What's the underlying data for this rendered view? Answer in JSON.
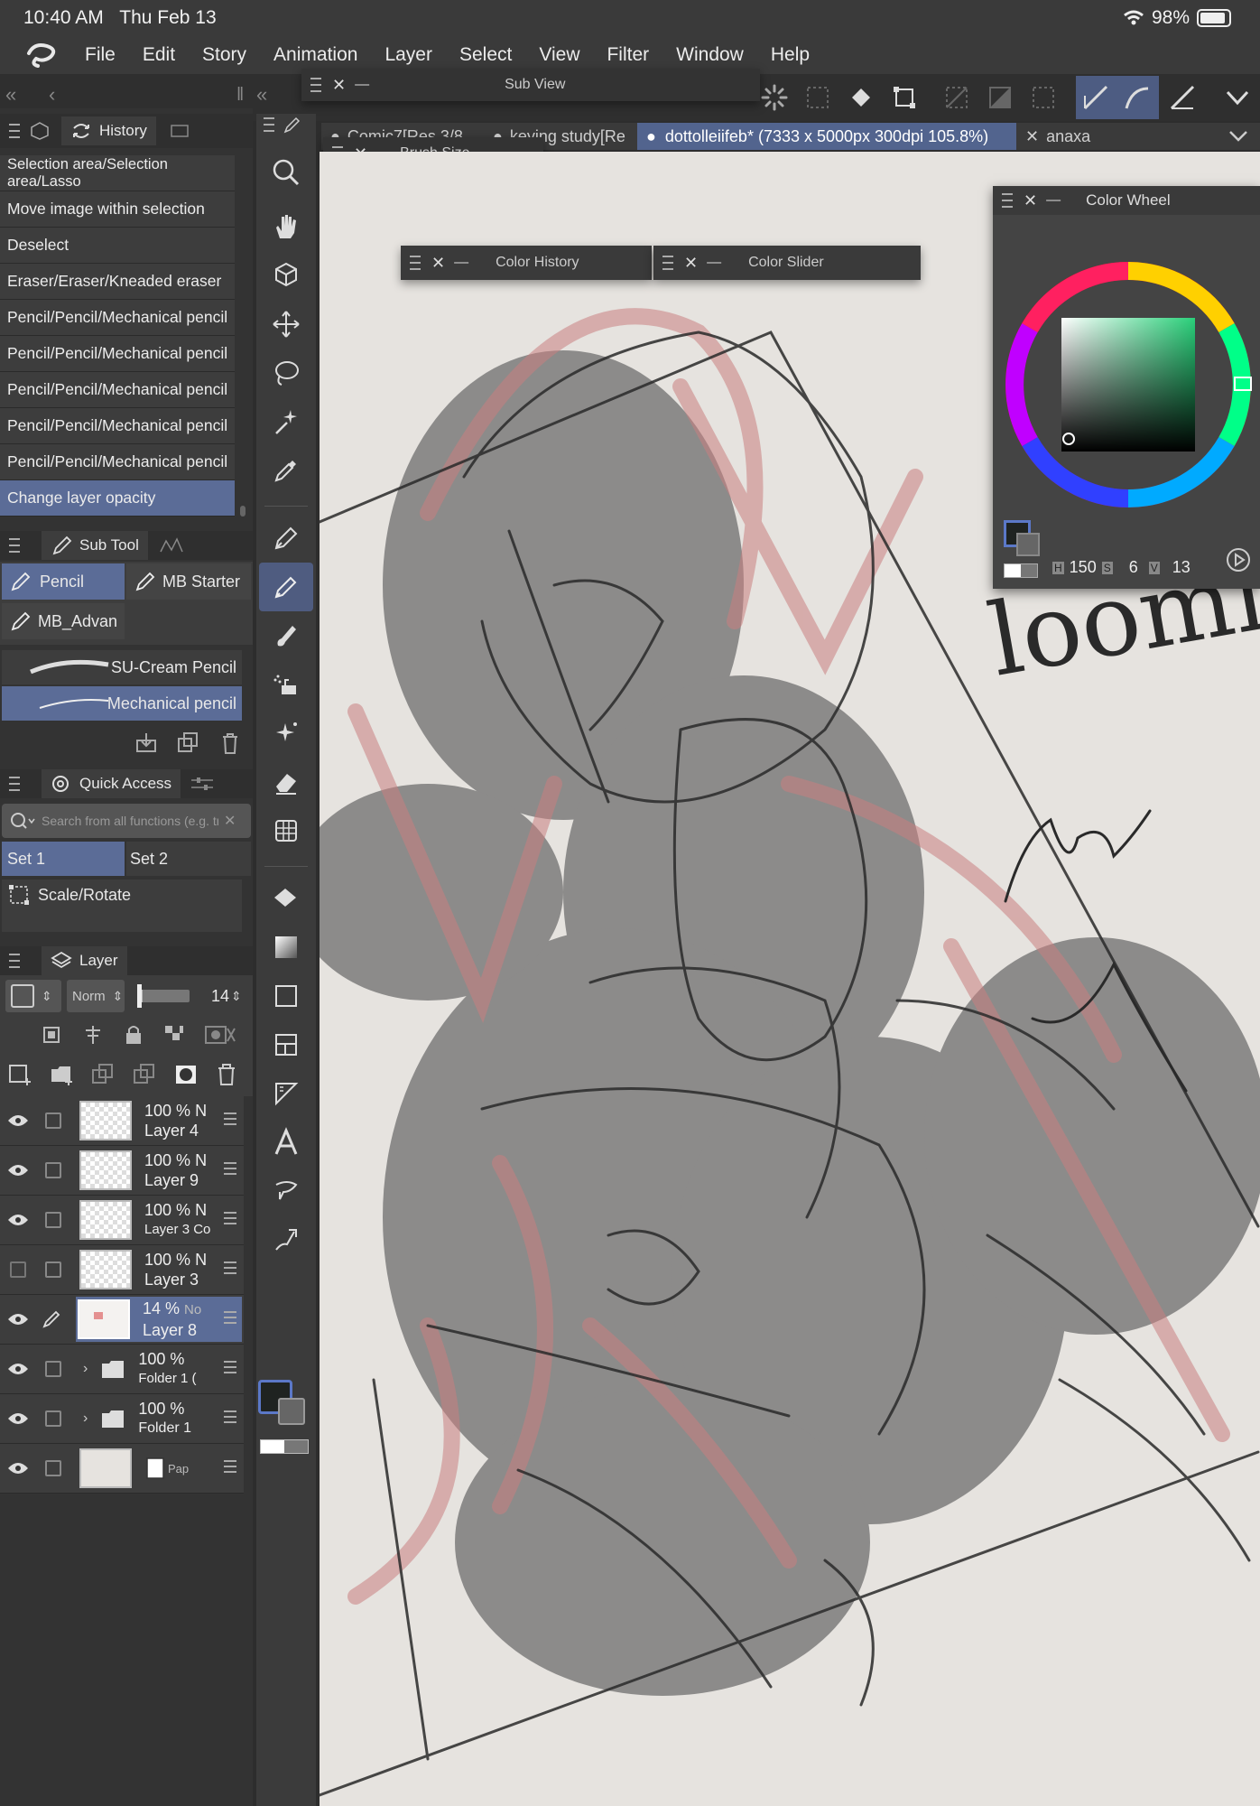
{
  "status_bar": {
    "time": "10:40 AM",
    "date": "Thu Feb 13",
    "battery": "98%"
  },
  "menu": [
    "File",
    "Edit",
    "Story",
    "Animation",
    "Layer",
    "Select",
    "View",
    "Filter",
    "Window",
    "Help"
  ],
  "sub_view": {
    "title": "Sub View"
  },
  "brush_size": {
    "title": "Brush Size"
  },
  "color_history": {
    "title": "Color History"
  },
  "color_slider": {
    "title": "Color Slider"
  },
  "color_wheel": {
    "title": "Color Wheel",
    "h_label": "H",
    "h": "150",
    "s_label": "S",
    "s": "6",
    "v_label": "V",
    "v": "13",
    "current_color": "#1f2321"
  },
  "tabs": [
    {
      "label": "Comic7[Res.3/8"
    },
    {
      "label": "keying study[Re"
    },
    {
      "label": "dottolleiifeb* (7333 x 5000px 300dpi 105.8%)"
    },
    {
      "label": "anaxa"
    }
  ],
  "history": {
    "title": "History",
    "items": [
      "Selection area/Selection area/Lasso",
      "Move image within selection",
      "Deselect",
      "Eraser/Eraser/Kneaded eraser",
      "Pencil/Pencil/Mechanical pencil",
      "Pencil/Pencil/Mechanical pencil",
      "Pencil/Pencil/Mechanical pencil",
      "Pencil/Pencil/Mechanical pencil",
      "Pencil/Pencil/Mechanical pencil",
      "Change layer opacity"
    ]
  },
  "sub_tool": {
    "title": "Sub Tool",
    "groups": [
      "Pencil",
      "MB Starter",
      "MB_Advan"
    ],
    "brushes": [
      "SU-Cream Pencil",
      "Mechanical pencil"
    ]
  },
  "quick_access": {
    "title": "Quick Access",
    "search_placeholder": "Search from all functions (e.g. tr",
    "sets": [
      "Set 1",
      "Set 2"
    ],
    "items": [
      "Scale/Rotate"
    ]
  },
  "layer_panel": {
    "title": "Layer",
    "blend_mode": "Norm",
    "opacity": "14",
    "layers": [
      {
        "opacity": "100 %",
        "mode": "N",
        "name": "Layer 4"
      },
      {
        "opacity": "100 %",
        "mode": "N",
        "name": "Layer 9"
      },
      {
        "opacity": "100 %",
        "mode": "N",
        "name": "Layer 3 Co"
      },
      {
        "opacity": "100 %",
        "mode": "N",
        "name": "Layer 3"
      },
      {
        "opacity": "14 %",
        "mode": "No",
        "name": "Layer 8"
      },
      {
        "opacity": "100 %",
        "mode": "",
        "name": "Folder 1 ("
      },
      {
        "opacity": "100 %",
        "mode": "",
        "name": "Folder 1"
      },
      {
        "opacity": "",
        "mode": "",
        "name": "Pap"
      }
    ]
  },
  "canvas_text": "loomi",
  "colors": {
    "accent": "#5b6c97",
    "canvas": "#e6e3df",
    "panel": "#3d3d3d"
  }
}
